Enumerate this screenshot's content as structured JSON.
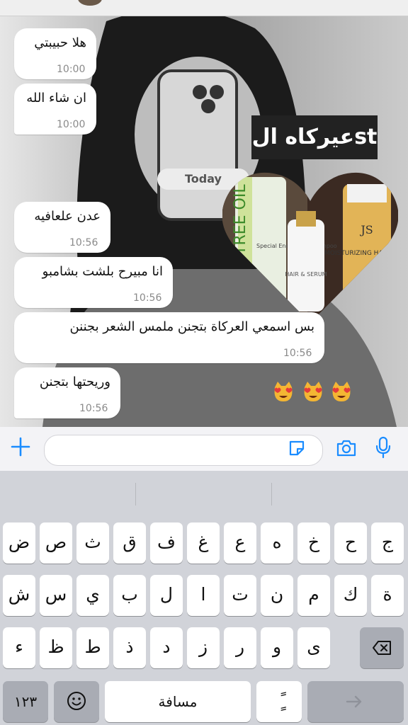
{
  "chat": {
    "day_divider": "Today",
    "messages": [
      {
        "text": "هلا حبيبتي",
        "time": "10:00"
      },
      {
        "text": "ان شاء الله",
        "time": "10:00"
      },
      {
        "text": "عدن علعافيه",
        "time": "10:56"
      },
      {
        "text": "انا مبيرح بلشت بشامبو",
        "time": "10:56"
      },
      {
        "text": "بس اسمعي العركاة بتجنن ملمس الشعر بجننن",
        "time": "10:56"
      },
      {
        "text": "وريحتها بتجنن",
        "time": "10:56"
      }
    ],
    "sticker_text": "عيركاه الst",
    "product_labels": {
      "left_bottle": "TREE OIL",
      "left_sub": "Special Energizing Shampoo",
      "middle_bottle": "HAIR & SERUM",
      "right_bottle": "MOISTURIZING HAIR MASK",
      "brand_mark": "JS"
    },
    "reaction_emoji": [
      "😻",
      "😻",
      "😻"
    ]
  },
  "input_bar": {
    "placeholder": "",
    "icons": [
      "plus-icon",
      "sticker-icon",
      "camera-icon",
      "microphone-icon"
    ]
  },
  "keyboard": {
    "row1": [
      "ض",
      "ص",
      "ث",
      "ق",
      "ف",
      "غ",
      "ع",
      "ه",
      "خ",
      "ح",
      "ج"
    ],
    "row2": [
      "ش",
      "س",
      "ي",
      "ب",
      "ل",
      "ا",
      "ت",
      "ن",
      "م",
      "ك",
      "ة"
    ],
    "row3": [
      "ء",
      "ظ",
      "ط",
      "ذ",
      "د",
      "ز",
      "ر",
      "و",
      "ى"
    ],
    "numbers_label": "١٢٣",
    "space_label": "مسافة",
    "diacritic_label": "ًٍ",
    "icons": [
      "emoji-icon",
      "delete-icon",
      "return-icon"
    ]
  },
  "colors": {
    "accent": "#1a8cff",
    "bubble": "#ffffff",
    "keyboard_bg": "#d1d3d9"
  }
}
